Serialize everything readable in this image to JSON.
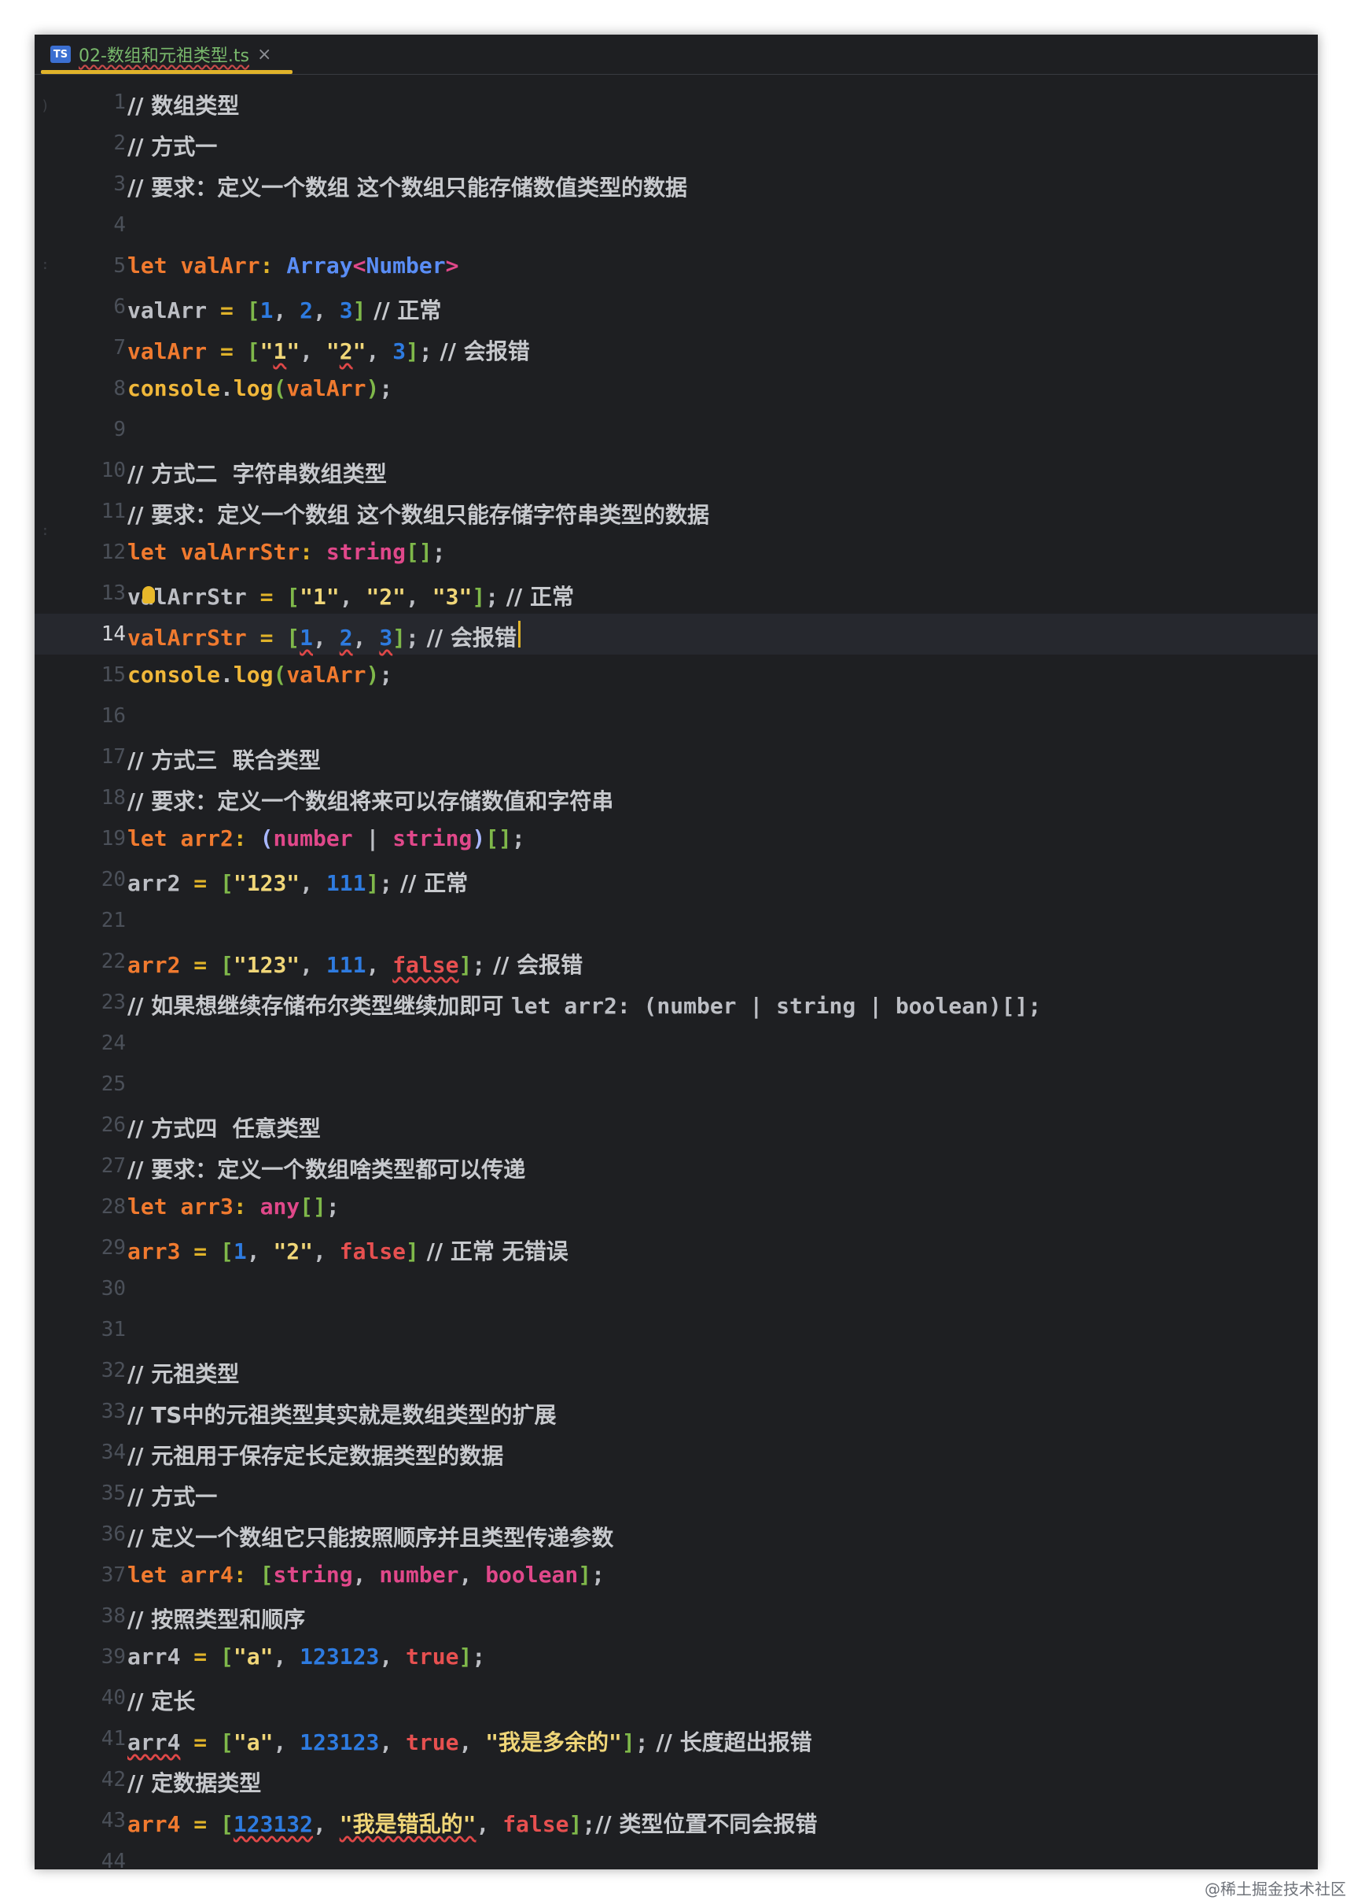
{
  "tab": {
    "icon_label": "TS",
    "file_name": "02-数组和元祖类型.ts",
    "close_symbol": "×"
  },
  "editor": {
    "current_line": 14
  },
  "lines": [
    [
      [
        "c",
        "// 数组类型"
      ]
    ],
    [
      [
        "c",
        "// 方式一"
      ]
    ],
    [
      [
        "c",
        "// 要求：定义一个数组 这个数组只能存储数值类型的数据"
      ]
    ],
    [],
    [
      [
        "kw",
        "let "
      ],
      [
        "vr",
        "valArr"
      ],
      [
        "op",
        ": "
      ],
      [
        "ty",
        "Array"
      ],
      [
        "tp",
        "<"
      ],
      [
        "ty",
        "Number"
      ],
      [
        "tp",
        ">"
      ]
    ],
    [
      [
        "vp",
        "valArr"
      ],
      [
        "op",
        " = "
      ],
      [
        "br",
        "["
      ],
      [
        "nm",
        "1"
      ],
      [
        "pu",
        ", "
      ],
      [
        "nm",
        "2"
      ],
      [
        "pu",
        ", "
      ],
      [
        "nm",
        "3"
      ],
      [
        "br",
        "]"
      ],
      [
        "c",
        " // 正常"
      ]
    ],
    [
      [
        "vr",
        "valArr"
      ],
      [
        "op",
        " = "
      ],
      [
        "br",
        "["
      ],
      [
        "st",
        "\""
      ],
      [
        "st err",
        "1"
      ],
      [
        "st",
        "\""
      ],
      [
        "pu",
        ", "
      ],
      [
        "st",
        "\""
      ],
      [
        "st err",
        "2"
      ],
      [
        "st",
        "\""
      ],
      [
        "pu",
        ", "
      ],
      [
        "nm",
        "3"
      ],
      [
        "br",
        "]"
      ],
      [
        "pu",
        ";"
      ],
      [
        "c",
        " // 会报错"
      ]
    ],
    [
      [
        "fn",
        "console"
      ],
      [
        "pu",
        "."
      ],
      [
        "fn",
        "log"
      ],
      [
        "br",
        "("
      ],
      [
        "vr",
        "valArr"
      ],
      [
        "br",
        ")"
      ],
      [
        "pu",
        ";"
      ]
    ],
    [],
    [
      [
        "c",
        "// 方式二  字符串数组类型"
      ]
    ],
    [
      [
        "c",
        "// 要求：定义一个数组 这个数组只能存储字符串类型的数据"
      ]
    ],
    [
      [
        "kw",
        "let "
      ],
      [
        "vr",
        "valArrStr"
      ],
      [
        "op",
        ": "
      ],
      [
        "tp",
        "string"
      ],
      [
        "br",
        "[]"
      ],
      [
        "pu",
        ";"
      ]
    ],
    [
      [
        "vp",
        "valArrStr"
      ],
      [
        "op",
        " = "
      ],
      [
        "br",
        "["
      ],
      [
        "st",
        "\"1\""
      ],
      [
        "pu",
        ", "
      ],
      [
        "st",
        "\"2\""
      ],
      [
        "pu",
        ", "
      ],
      [
        "st",
        "\"3\""
      ],
      [
        "br",
        "]"
      ],
      [
        "pu",
        ";"
      ],
      [
        "c",
        " // 正常"
      ]
    ],
    [
      [
        "vr",
        "valArrStr"
      ],
      [
        "op",
        " = "
      ],
      [
        "br",
        "["
      ],
      [
        "nm err",
        "1"
      ],
      [
        "pu",
        ", "
      ],
      [
        "nm err",
        "2"
      ],
      [
        "pu",
        ", "
      ],
      [
        "nm err",
        "3"
      ],
      [
        "br",
        "]"
      ],
      [
        "pu",
        ";"
      ],
      [
        "c",
        " // 会报错"
      ]
    ],
    [
      [
        "fn",
        "console"
      ],
      [
        "pu",
        "."
      ],
      [
        "fn",
        "log"
      ],
      [
        "br",
        "("
      ],
      [
        "vr",
        "valArr"
      ],
      [
        "br",
        ")"
      ],
      [
        "pu",
        ";"
      ]
    ],
    [],
    [
      [
        "c",
        "// 方式三  联合类型"
      ]
    ],
    [
      [
        "c",
        "// 要求：定义一个数组将来可以存储数值和字符串"
      ]
    ],
    [
      [
        "kw",
        "let "
      ],
      [
        "vr",
        "arr2"
      ],
      [
        "op",
        ": "
      ],
      [
        "pb",
        "("
      ],
      [
        "tp",
        "number"
      ],
      [
        "pu",
        " | "
      ],
      [
        "tp",
        "string"
      ],
      [
        "pb",
        ")"
      ],
      [
        "br",
        "[]"
      ],
      [
        "pu",
        ";"
      ]
    ],
    [
      [
        "vp",
        "arr2"
      ],
      [
        "op",
        " = "
      ],
      [
        "br",
        "["
      ],
      [
        "st",
        "\"123\""
      ],
      [
        "pu",
        ", "
      ],
      [
        "nm",
        "111"
      ],
      [
        "br",
        "]"
      ],
      [
        "pu",
        ";"
      ],
      [
        "c",
        " // 正常"
      ]
    ],
    [],
    [
      [
        "vr",
        "arr2"
      ],
      [
        "op",
        " = "
      ],
      [
        "br",
        "["
      ],
      [
        "st",
        "\"123\""
      ],
      [
        "pu",
        ", "
      ],
      [
        "nm",
        "111"
      ],
      [
        "pu",
        ", "
      ],
      [
        "bl err",
        "false"
      ],
      [
        "br",
        "]"
      ],
      [
        "pu",
        ";"
      ],
      [
        "c",
        " // 会报错"
      ]
    ],
    [
      [
        "c",
        "// 如果想继续存储布尔类型继续加即可 "
      ],
      [
        "vp",
        "let arr2: (number | string | boolean)[];"
      ]
    ],
    [],
    [],
    [
      [
        "c",
        "// 方式四  任意类型"
      ]
    ],
    [
      [
        "c",
        "// 要求：定义一个数组啥类型都可以传递"
      ]
    ],
    [
      [
        "kw",
        "let "
      ],
      [
        "vr",
        "arr3"
      ],
      [
        "op",
        ": "
      ],
      [
        "tp",
        "any"
      ],
      [
        "br",
        "[]"
      ],
      [
        "pu",
        ";"
      ]
    ],
    [
      [
        "vr",
        "arr3"
      ],
      [
        "op",
        " = "
      ],
      [
        "br",
        "["
      ],
      [
        "nm",
        "1"
      ],
      [
        "pu",
        ", "
      ],
      [
        "st",
        "\"2\""
      ],
      [
        "pu",
        ", "
      ],
      [
        "bl",
        "false"
      ],
      [
        "br",
        "]"
      ],
      [
        "c",
        " // 正常 无错误"
      ]
    ],
    [],
    [],
    [
      [
        "c",
        "// 元祖类型"
      ]
    ],
    [
      [
        "c",
        "// TS中的元祖类型其实就是数组类型的扩展"
      ]
    ],
    [
      [
        "c",
        "// 元祖用于保存定长定数据类型的数据"
      ]
    ],
    [
      [
        "c",
        "// 方式一"
      ]
    ],
    [
      [
        "c",
        "// 定义一个数组它只能按照顺序并且类型传递参数"
      ]
    ],
    [
      [
        "kw",
        "let "
      ],
      [
        "vr",
        "arr4"
      ],
      [
        "op",
        ": "
      ],
      [
        "br",
        "["
      ],
      [
        "tp",
        "string"
      ],
      [
        "pu",
        ", "
      ],
      [
        "tp",
        "number"
      ],
      [
        "pu",
        ", "
      ],
      [
        "tp",
        "boolean"
      ],
      [
        "br",
        "]"
      ],
      [
        "pu",
        ";"
      ]
    ],
    [
      [
        "c",
        "// 按照类型和顺序"
      ]
    ],
    [
      [
        "vp",
        "arr4"
      ],
      [
        "op",
        " = "
      ],
      [
        "br",
        "["
      ],
      [
        "st",
        "\"a\""
      ],
      [
        "pu",
        ", "
      ],
      [
        "nm",
        "123123"
      ],
      [
        "pu",
        ", "
      ],
      [
        "bl",
        "true"
      ],
      [
        "br",
        "]"
      ],
      [
        "pu",
        ";"
      ]
    ],
    [
      [
        "c",
        "// 定长"
      ]
    ],
    [
      [
        "vp err",
        "arr4"
      ],
      [
        "op",
        " = "
      ],
      [
        "br",
        "["
      ],
      [
        "st",
        "\"a\""
      ],
      [
        "pu",
        ", "
      ],
      [
        "nm",
        "123123"
      ],
      [
        "pu",
        ", "
      ],
      [
        "bl",
        "true"
      ],
      [
        "pu",
        ", "
      ],
      [
        "st",
        "\"我是多余的\""
      ],
      [
        "br",
        "]"
      ],
      [
        "pu",
        ";"
      ],
      [
        "c",
        " // 长度超出报错"
      ]
    ],
    [
      [
        "c",
        "// 定数据类型"
      ]
    ],
    [
      [
        "vr",
        "arr4"
      ],
      [
        "op",
        " = "
      ],
      [
        "br",
        "["
      ],
      [
        "nm err",
        "123132"
      ],
      [
        "pu",
        ", "
      ],
      [
        "st err",
        "\"我是错乱的\""
      ],
      [
        "pu",
        ", "
      ],
      [
        "bl",
        "false"
      ],
      [
        "br",
        "]"
      ],
      [
        "pu",
        ";"
      ],
      [
        "c",
        "// 类型位置不同会报错"
      ]
    ],
    []
  ],
  "watermark": "@稀土掘金技术社区"
}
